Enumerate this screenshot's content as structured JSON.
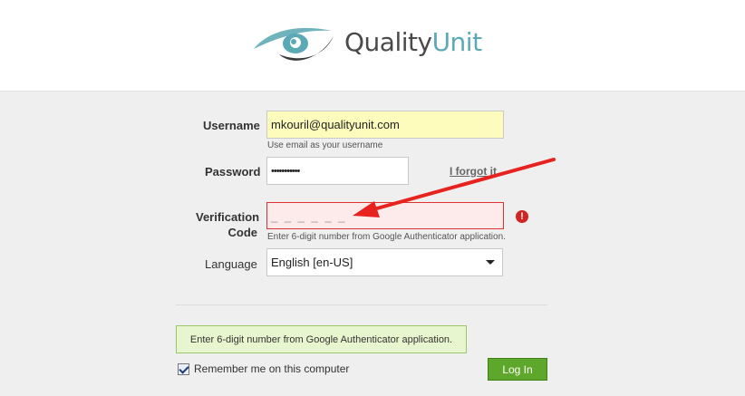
{
  "brand": {
    "name_part1": "Quality",
    "name_part2": "Unit",
    "accent": "#5aa9b5"
  },
  "form": {
    "username": {
      "label": "Username",
      "value": "mkouril@qualityunit.com",
      "hint": "Use email as your username"
    },
    "password": {
      "label": "Password",
      "value": "•••••••••••",
      "forgot": "I forgot it"
    },
    "verification": {
      "label_line1": "Verification",
      "label_line2": "Code",
      "placeholder": "_ _ _ _ _ _",
      "hint": "Enter 6-digit number from Google Authenticator application.",
      "error_icon": "!"
    },
    "language": {
      "label": "Language",
      "selected": "English [en-US]"
    }
  },
  "notice": "Enter 6-digit number from Google Authenticator application.",
  "remember_label": "Remember me on this computer",
  "login_label": "Log In",
  "annotation": {
    "color": "#e8231f"
  }
}
